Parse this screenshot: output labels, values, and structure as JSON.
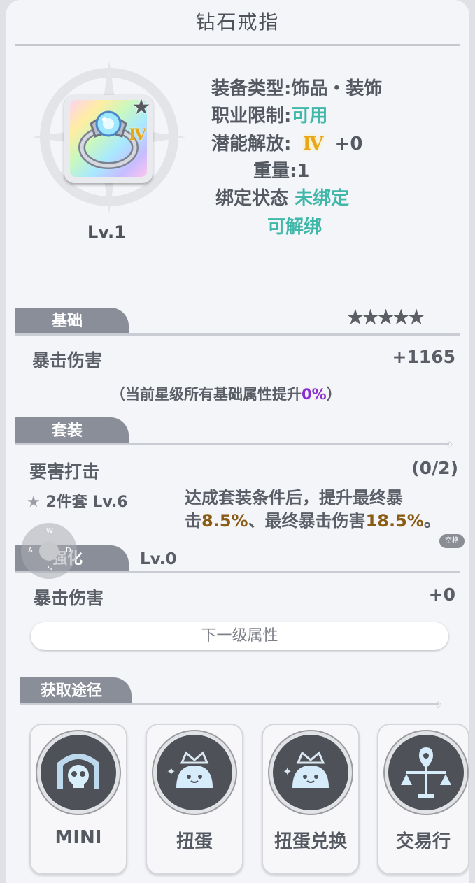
{
  "header": {
    "title": "钻石戒指"
  },
  "item": {
    "level": "Lv.1",
    "tier_badge": "Ⅳ",
    "star_icon": "star-icon",
    "info": {
      "type_label": "装备类型:",
      "type_value": "饰品・装饰",
      "class_label": "职业限制:",
      "class_value": "可用",
      "potential_label": "潜能解放:",
      "potential_badge": "Ⅳ",
      "potential_value": "+0",
      "weight": "重量:1",
      "bind_label": "绑定状态",
      "bind_value": "未绑定",
      "unbind": "可解绑"
    }
  },
  "basic": {
    "tab": "基础",
    "stars_total": 5,
    "stat_name": "暴击伤害",
    "stat_value": "+1165",
    "note_prefix": "（当前星级所有基础属性提升",
    "note_percent": "0%",
    "note_suffix": "）"
  },
  "set": {
    "tab": "套装",
    "name": "要害打击",
    "progress": "(0/2)",
    "pieces": "2件套 Lv.6",
    "desc_line1": "达成套装条件后，提升最终暴",
    "desc_line2_a": "击",
    "desc_line2_b": "8.5%",
    "desc_line2_c": "、最终暴击伤害",
    "desc_line2_d": "18.5%",
    "desc_line2_e": "。"
  },
  "enhance": {
    "tab": "强化",
    "level": "Lv.0",
    "stat_name": "暴击伤害",
    "stat_value": "+0",
    "next_button": "下一级属性"
  },
  "sources": {
    "tab": "获取途径",
    "items": [
      {
        "label": "MINI",
        "icon": "skull-dungeon-icon"
      },
      {
        "label": "扭蛋",
        "icon": "crowned-slime-icon"
      },
      {
        "label": "扭蛋兑换",
        "icon": "crowned-slime-icon"
      },
      {
        "label": "交易行",
        "icon": "scales-icon"
      }
    ]
  },
  "overlay": {
    "keys": {
      "up": "W",
      "left": "A",
      "right": "D",
      "down": "S"
    },
    "space": "空格"
  }
}
